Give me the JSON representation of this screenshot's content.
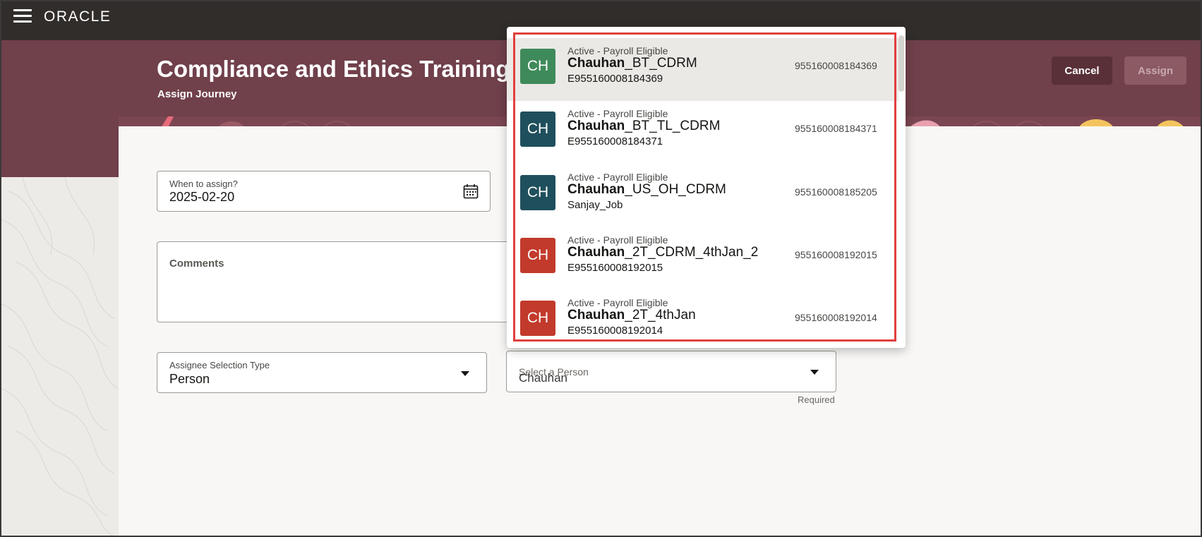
{
  "brand": {
    "logo_text": "ORACLE"
  },
  "header": {
    "title": "Compliance and Ethics Training",
    "subtitle": "Assign Journey",
    "cancel_label": "Cancel",
    "assign_label": "Assign"
  },
  "form": {
    "when_label": "When to assign?",
    "when_value": "2025-02-20",
    "comments_label": "Comments",
    "assignee_type_label": "Assignee Selection Type",
    "assignee_type_value": "Person",
    "person_label": "Select a Person",
    "person_value": "Chauhan",
    "required_text": "Required"
  },
  "dropdown": {
    "options": [
      {
        "initials": "CH",
        "status": "Active - Payroll Eligible",
        "match": "Chauhan",
        "name_rest": "_BT_CDRM",
        "sub": "E955160008184369",
        "number": "955160008184369",
        "color": "#3f8a5a"
      },
      {
        "initials": "CH",
        "status": "Active - Payroll Eligible",
        "match": "Chauhan",
        "name_rest": "_BT_TL_CDRM",
        "sub": "E955160008184371",
        "number": "955160008184371",
        "color": "#1f4f5c"
      },
      {
        "initials": "CH",
        "status": "Active - Payroll Eligible",
        "match": "Chauhan",
        "name_rest": "_US_OH_CDRM",
        "sub": "Sanjay_Job",
        "number": "955160008185205",
        "color": "#1f4f5c"
      },
      {
        "initials": "CH",
        "status": "Active - Payroll Eligible",
        "match": "Chauhan",
        "name_rest": "_2T_CDRM_4thJan_2",
        "sub": "E955160008192015",
        "number": "955160008192015",
        "color": "#c23a2b"
      },
      {
        "initials": "CH",
        "status": "Active - Payroll Eligible",
        "match": "Chauhan",
        "name_rest": "_2T_4thJan",
        "sub": "E955160008192014",
        "number": "955160008192014",
        "color": "#c23a2b"
      }
    ]
  },
  "colors": {
    "topbar": "#312d2a",
    "hero": "#70404b",
    "highlight": "#e0403e"
  }
}
